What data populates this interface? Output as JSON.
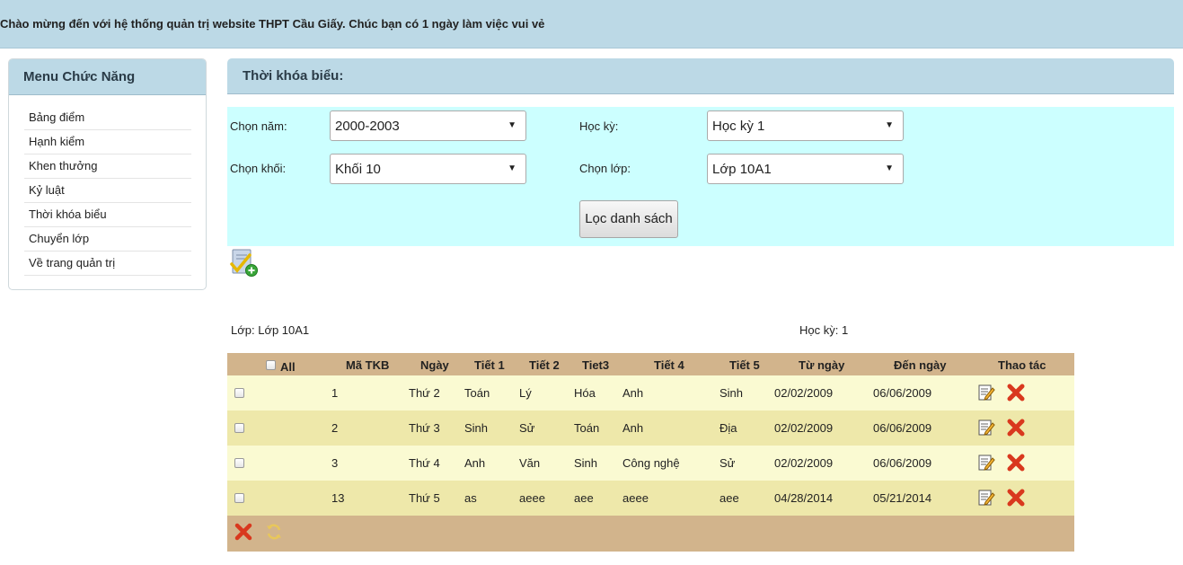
{
  "header": {
    "welcome": "Chào mừng đến với hệ thống quản trị website THPT Cầu Giấy. Chúc bạn có 1 ngày làm việc vui vẻ"
  },
  "sidebar": {
    "title": "Menu Chức Năng",
    "items": [
      {
        "label": "Bảng điểm"
      },
      {
        "label": "Hạnh kiểm"
      },
      {
        "label": "Khen thưởng"
      },
      {
        "label": "Kỷ luật"
      },
      {
        "label": "Thời khóa biểu"
      },
      {
        "label": "Chuyển lớp"
      },
      {
        "label": "Về trang quản trị"
      }
    ]
  },
  "main": {
    "title": "Thời khóa biểu:",
    "filter": {
      "year_label": "Chọn năm:",
      "year_value": "2000-2003",
      "semester_label": "Học kỳ:",
      "semester_value": "Học kỳ 1",
      "grade_label": "Chọn khối:",
      "grade_value": "Khối 10",
      "class_label": "Chọn lớp:",
      "class_value": "Lớp 10A1",
      "button": "Lọc danh sách"
    },
    "info": {
      "class": "Lớp: Lớp 10A1",
      "semester": "Học kỳ: 1"
    },
    "table": {
      "headers": [
        "All",
        "Mã TKB",
        "Ngày",
        "Tiết 1",
        "Tiết 2",
        "Tiet3",
        "Tiết 4",
        "Tiết 5",
        "Từ ngày",
        "Đến ngày",
        "Thao tác"
      ],
      "rows": [
        {
          "id": "1",
          "day": "Thứ 2",
          "t1": "Toán",
          "t2": "Lý",
          "t3": "Hóa",
          "t4": "Anh",
          "t5": "Sinh",
          "from": "02/02/2009",
          "to": "06/06/2009"
        },
        {
          "id": "2",
          "day": "Thứ 3",
          "t1": "Sinh",
          "t2": "Sử",
          "t3": "Toán",
          "t4": "Anh",
          "t5": "Địa",
          "from": "02/02/2009",
          "to": "06/06/2009"
        },
        {
          "id": "3",
          "day": "Thứ 4",
          "t1": "Anh",
          "t2": "Văn",
          "t3": "Sinh",
          "t4": "Công nghệ",
          "t5": "Sử",
          "from": "02/02/2009",
          "to": "06/06/2009"
        },
        {
          "id": "13",
          "day": "Thứ 5",
          "t1": "as",
          "t2": "aeee",
          "t3": "aee",
          "t4": "aeee",
          "t5": "aee",
          "from": "04/28/2014",
          "to": "05/21/2014"
        }
      ]
    }
  },
  "icons": {
    "add": "add-schedule-icon",
    "edit": "edit-icon",
    "delete": "delete-icon",
    "refresh": "refresh-icon"
  },
  "colors": {
    "header_bg": "#bcd9e6",
    "filter_bg": "#ccffff",
    "table_head_bg": "#d2b48c",
    "row_odd": "#fafad2",
    "row_even": "#eee8aa",
    "delete_red": "#d9381e"
  }
}
